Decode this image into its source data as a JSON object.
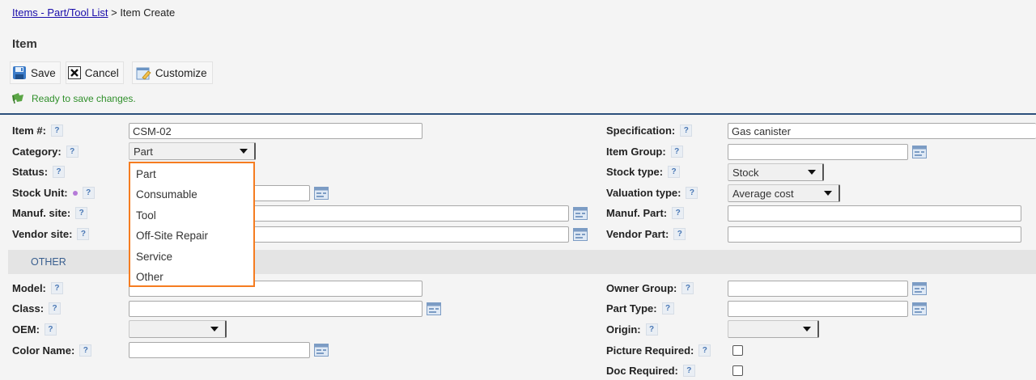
{
  "breadcrumb": {
    "link": "Items - Part/Tool List",
    "separator": " > ",
    "current": "Item Create"
  },
  "page_title": "Item",
  "toolbar": {
    "save": "Save",
    "cancel": "Cancel",
    "customize": "Customize"
  },
  "status_message": "Ready to save changes.",
  "help_glyph": "?",
  "fields": {
    "item_no": {
      "label": "Item #:",
      "value": "CSM-02"
    },
    "category": {
      "label": "Category:",
      "value": "Part"
    },
    "status": {
      "label": "Status:"
    },
    "stock_unit": {
      "label": "Stock Unit:",
      "value": ""
    },
    "manuf_site": {
      "label": "Manuf. site:",
      "value": ""
    },
    "vendor_site": {
      "label": "Vendor site:",
      "value": ""
    },
    "specification": {
      "label": "Specification:",
      "value": "Gas canister"
    },
    "item_group": {
      "label": "Item Group:",
      "value": ""
    },
    "stock_type": {
      "label": "Stock type:",
      "value": "Stock"
    },
    "valuation_type": {
      "label": "Valuation type:",
      "value": "Average cost"
    },
    "manuf_part": {
      "label": "Manuf. Part:",
      "value": ""
    },
    "vendor_part": {
      "label": "Vendor Part:",
      "value": ""
    }
  },
  "category_options": [
    "Part",
    "Consumable",
    "Tool",
    "Off-Site Repair",
    "Service",
    "Other"
  ],
  "other_section": {
    "title": "OTHER",
    "model": {
      "label": "Model:",
      "value": ""
    },
    "class": {
      "label": "Class:",
      "value": ""
    },
    "oem": {
      "label": "OEM:",
      "value": ""
    },
    "color_name": {
      "label": "Color Name:",
      "value": ""
    },
    "owner_group": {
      "label": "Owner Group:",
      "value": ""
    },
    "part_type": {
      "label": "Part Type:",
      "value": ""
    },
    "origin": {
      "label": "Origin:",
      "value": ""
    },
    "picture_required": {
      "label": "Picture Required:",
      "checked": false
    },
    "doc_required": {
      "label": "Doc Required:",
      "checked": false
    }
  },
  "colors": {
    "accent_border": "#f57c20",
    "divider": "#2c4f7c",
    "status_text": "#2f8f2a",
    "link": "#1a0dab"
  }
}
